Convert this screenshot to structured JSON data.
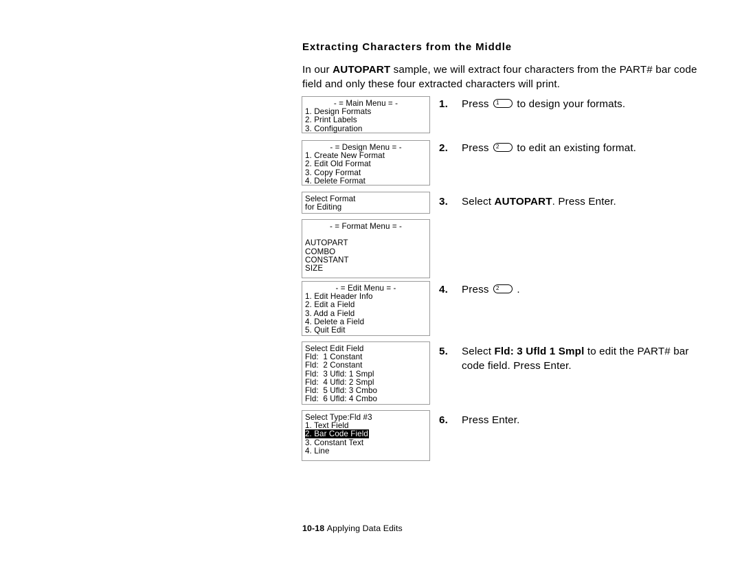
{
  "document": {
    "heading": "Extracting Characters from the Middle",
    "intro": {
      "before_bold": "In our ",
      "bold": "AUTOPART",
      "after_bold": " sample, we will extract four characters from the PART# bar code field and only these four extracted characters will print."
    },
    "footer": {
      "page_number": "10-18",
      "section_title": "Applying Data Edits"
    }
  },
  "lcd_screens": [
    {
      "name": "main-menu",
      "title": "- = Main Menu = -",
      "lines": [
        "1. Design Formats",
        "2. Print Labels",
        "3. Configuration"
      ]
    },
    {
      "name": "design-menu",
      "title": "- = Design Menu = -",
      "lines": [
        "1. Create New Format",
        "2. Edit Old Format",
        "3. Copy Format",
        "4. Delete Format"
      ]
    },
    {
      "name": "select-format",
      "title": "",
      "lines": [
        "Select Format",
        "for Editing"
      ]
    },
    {
      "name": "format-menu",
      "title": "- = Format Menu = -",
      "lines": [
        "",
        "AUTOPART",
        "COMBO",
        "CONSTANT",
        "SIZE"
      ]
    },
    {
      "name": "edit-menu",
      "title": "- = Edit Menu = -",
      "lines": [
        "1. Edit Header Info",
        "2. Edit a Field",
        "3. Add a Field",
        "4. Delete a Field",
        "5. Quit Edit"
      ]
    },
    {
      "name": "select-edit-field",
      "title": "",
      "lines": [
        "Select Edit Field",
        "Fld:  1 Constant",
        "Fld:  2 Constant",
        "Fld:  3 Ufld: 1 Smpl",
        "Fld:  4 Ufld: 2 Smpl",
        "Fld:  5 Ufld: 3 Cmbo",
        "Fld:  6 Ufld: 4 Cmbo"
      ]
    },
    {
      "name": "select-type",
      "title": "",
      "lines": [
        "Select Type:Fld #3",
        "1. Text Field",
        "2. Bar Code Field",
        "3. Constant Text",
        "4. Line"
      ],
      "highlighted_line_index": 2
    }
  ],
  "steps": [
    {
      "number": "1.",
      "text_before_key": "Press ",
      "key_label": "1",
      "text_after_key": " to design your formats.",
      "bold_term": "",
      "text_after_bold": ""
    },
    {
      "number": "2.",
      "text_before_key": "Press ",
      "key_label": "2",
      "text_after_key": " to edit an existing format.",
      "bold_term": "",
      "text_after_bold": ""
    },
    {
      "number": "3.",
      "text_before_key": "Select ",
      "key_label": "",
      "text_after_key": "",
      "bold_term": "AUTOPART",
      "text_after_bold": ".  Press Enter."
    },
    {
      "number": "4.",
      "text_before_key": "Press ",
      "key_label": "2",
      "text_after_key": " .",
      "bold_term": "",
      "text_after_bold": ""
    },
    {
      "number": "5.",
      "text_before_key": "Select ",
      "key_label": "",
      "text_after_key": "",
      "bold_term": "Fld:  3 Ufld 1 Smpl",
      "text_after_bold": " to edit the PART# bar code field.  Press Enter."
    },
    {
      "number": "6.",
      "text_before_key": "Press Enter.",
      "key_label": "",
      "text_after_key": "",
      "bold_term": "",
      "text_after_bold": ""
    }
  ]
}
